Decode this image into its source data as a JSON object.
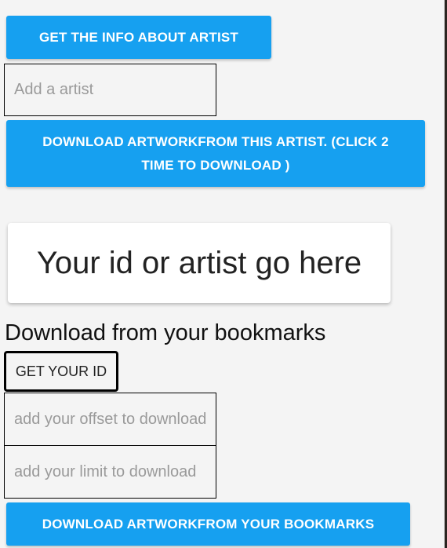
{
  "artist_section": {
    "info_button_label": "GET THE INFO ABOUT ARTIST",
    "artist_input_placeholder": "Add a artist",
    "artist_input_value": "",
    "download_artist_button_label": "DOWNLOAD ARTWORKFROM THIS ARTIST. (CLICK 2 TIME TO DOWNLOAD )"
  },
  "result": {
    "text": "Your id or artist go here"
  },
  "bookmarks_section": {
    "title": "Download from your bookmarks",
    "get_id_button_label": "GET YOUR ID",
    "offset_input_placeholder": "add your offset to download",
    "offset_input_value": "",
    "limit_input_placeholder": "add your limit to download",
    "limit_input_value": "",
    "download_bookmarks_button_label": "DOWNLOAD ARTWORKFROM YOUR BOOKMARKS"
  },
  "colors": {
    "accent_blue": "#16a0f0",
    "background": "#f4f4f4"
  }
}
